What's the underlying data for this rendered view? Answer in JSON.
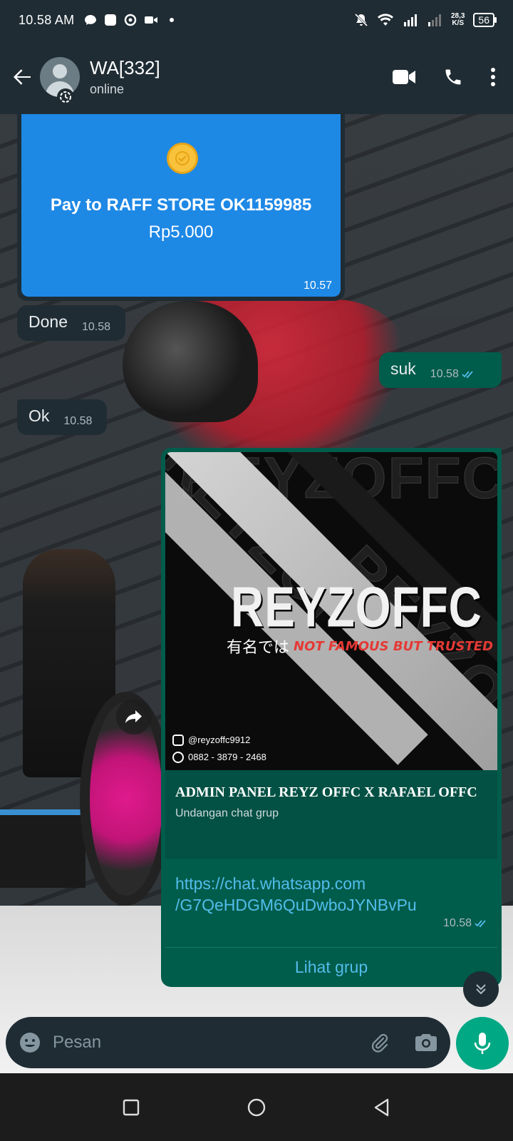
{
  "status_bar": {
    "time": "10.58 AM",
    "net_speed_value": "28,3",
    "net_speed_unit": "K/S",
    "battery": "56",
    "icons": [
      "chat-icon",
      "app-icon",
      "record-icon",
      "video-icon",
      "dot-icon",
      "mute-icon",
      "wifi-icon",
      "signal-icon",
      "signal-icon"
    ]
  },
  "header": {
    "contact_name": "WA[332]",
    "contact_status": "online",
    "accent": "#1f2c34"
  },
  "messages": {
    "payment": {
      "title": "Pay to RAFF STORE OK1159985",
      "amount": "Rp5.000",
      "time": "10.57",
      "card_color": "#1e88e5"
    },
    "done": {
      "text": "Done",
      "time": "10.58"
    },
    "suk": {
      "text": "suk",
      "time": "10.58"
    },
    "ok": {
      "text": "Ok",
      "time": "10.58"
    },
    "invite": {
      "image": {
        "logo": "REYZOFFC",
        "tagline_jp": "有名では",
        "tagline_en": "NOT FAMOUS BUT TRUSTED",
        "instagram": "@reyzoffc9912",
        "phone": "0882 - 3879 - 2468"
      },
      "title": "ADMIN PANEL REYZ OFFC X RAFAEL OFFC",
      "subtitle": "Undangan chat grup",
      "link_line1": "https://chat.whatsapp.com",
      "link_line2": "/G7QeHDGM6QuDwboJYNBvPu",
      "time": "10.58",
      "action": "Lihat grup"
    }
  },
  "composer": {
    "placeholder": "Pesan"
  },
  "colors": {
    "incoming": "#1f2c34",
    "outgoing": "#005c4b",
    "link": "#53bdeb",
    "send": "#00a884"
  }
}
